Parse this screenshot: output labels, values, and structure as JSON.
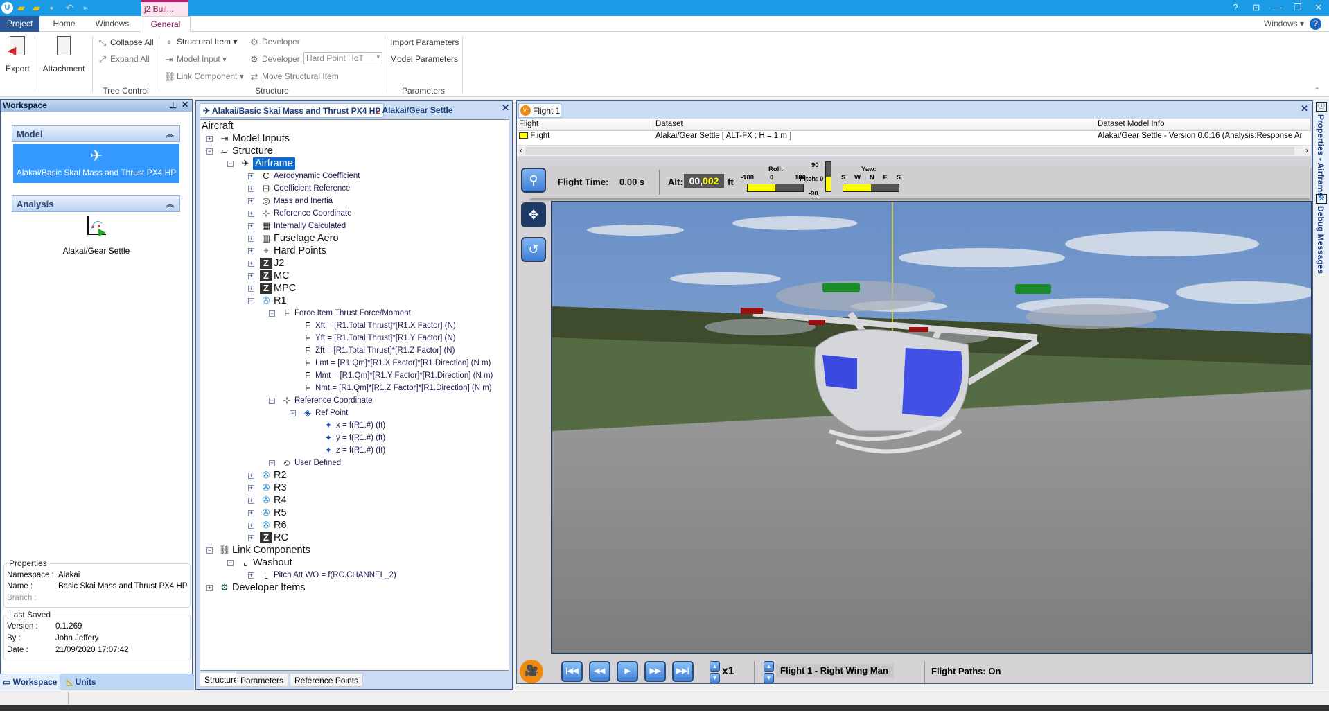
{
  "titlebar": {
    "doc_tab": "j2 Buil...",
    "buttons": [
      "help",
      "restore-ribbon",
      "minimize",
      "restore",
      "close"
    ]
  },
  "ribbon_tabs": [
    "Project",
    "Home",
    "Windows",
    "General"
  ],
  "ribbon_right": {
    "windows": "Windows"
  },
  "ribbon": {
    "export": "Export",
    "attachment": "Attachment",
    "collapse_all": "Collapse All",
    "expand_all": "Expand All",
    "tree_control": "Tree Control",
    "structural_item": "Structural Item",
    "model_input": "Model Input",
    "link_component": "Link Component",
    "developer1": "Developer",
    "developer2": "Developer",
    "developer_combo": "Hard Point HoT",
    "move_structural_item": "Move Structural Item",
    "structure": "Structure",
    "import_parameters": "Import Parameters",
    "model_parameters": "Model Parameters",
    "parameters": "Parameters"
  },
  "workspace": {
    "title": "Workspace",
    "model_header": "Model",
    "model_item": "Alakai/Basic Skai Mass and Thrust PX4 HP",
    "analysis_header": "Analysis",
    "analysis_item": "Alakai/Gear Settle",
    "properties": {
      "legend": "Properties",
      "namespace_label": "Namespace :",
      "namespace": "Alakai",
      "name_label": "Name :",
      "name": "Basic Skai Mass and Thrust PX4 HP",
      "branch_label": "Branch :"
    },
    "last_saved": {
      "legend": "Last Saved",
      "version_label": "Version :",
      "version": "0.1.269",
      "by_label": "By :",
      "by": "John Jeffery",
      "date_label": "Date :",
      "date": "21/09/2020 17:07:42"
    },
    "tabs": [
      "Workspace",
      "Units"
    ]
  },
  "tree_panel": {
    "tabs": [
      "Alakai/Basic Skai Mass and Thrust PX4 HP",
      "Alakai/Gear Settle"
    ],
    "root": "Aircraft",
    "items": [
      {
        "label": "Model Inputs",
        "level": 0,
        "toggle": "+",
        "icon": "model-input-icon",
        "big": true
      },
      {
        "label": "Structure",
        "level": 0,
        "toggle": "-",
        "icon": "structure-icon",
        "big": true
      },
      {
        "label": "Airframe",
        "level": 1,
        "toggle": "-",
        "icon": "airframe-icon",
        "big": true,
        "selected": true
      },
      {
        "label": "Aerodynamic Coefficient",
        "level": 2,
        "toggle": "+",
        "icon": "coefficient-icon"
      },
      {
        "label": "Coefficient Reference",
        "level": 2,
        "toggle": "+",
        "icon": "coefficient-reference-icon"
      },
      {
        "label": "Mass and Inertia",
        "level": 2,
        "toggle": "+",
        "icon": "mass-inertia-icon"
      },
      {
        "label": "Reference Coordinate",
        "level": 2,
        "toggle": "+",
        "icon": "reference-coordinate-icon"
      },
      {
        "label": "Internally Calculated",
        "level": 2,
        "toggle": "+",
        "icon": "calculator-icon"
      },
      {
        "label": "Fuselage Aero",
        "level": 2,
        "toggle": "+",
        "icon": "fuselage-aero-icon",
        "big": true
      },
      {
        "label": "Hard Points",
        "level": 2,
        "toggle": "+",
        "icon": "hard-point-icon",
        "big": true
      },
      {
        "label": "J2",
        "level": 2,
        "toggle": "+",
        "icon": "z-block-icon",
        "big": true
      },
      {
        "label": "MC",
        "level": 2,
        "toggle": "+",
        "icon": "z-block-icon",
        "big": true
      },
      {
        "label": "MPC",
        "level": 2,
        "toggle": "+",
        "icon": "z-block-icon",
        "big": true
      },
      {
        "label": "R1",
        "level": 2,
        "toggle": "-",
        "icon": "rotor-icon",
        "big": true
      },
      {
        "label": "Force Item Thrust Force/Moment",
        "level": 3,
        "toggle": "-",
        "icon": "force-moment-icon"
      },
      {
        "label": "Xft = [R1.Total Thrust]*[R1.X Factor] (N)",
        "level": 4,
        "icon": "force-icon"
      },
      {
        "label": "Yft = [R1.Total Thrust]*[R1.Y Factor] (N)",
        "level": 4,
        "icon": "force-icon"
      },
      {
        "label": "Zft = [R1.Total Thrust]*[R1.Z Factor] (N)",
        "level": 4,
        "icon": "force-icon"
      },
      {
        "label": "Lmt = [R1.Qm]*[R1.X Factor]*[R1.Direction] (N m)",
        "level": 4,
        "icon": "force-icon"
      },
      {
        "label": "Mmt = [R1.Qm]*[R1.Y Factor]*[R1.Direction] (N m)",
        "level": 4,
        "icon": "force-icon"
      },
      {
        "label": "Nmt = [R1.Qm]*[R1.Z Factor]*[R1.Direction] (N m)",
        "level": 4,
        "icon": "force-icon"
      },
      {
        "label": "Reference Coordinate",
        "level": 3,
        "toggle": "-",
        "icon": "reference-coordinate-icon"
      },
      {
        "label": "Ref Point",
        "level": 4,
        "toggle": "-",
        "icon": "ref-point-icon"
      },
      {
        "label": "x = f(R1.#) (ft)",
        "level": 5,
        "icon": "crosshair-icon"
      },
      {
        "label": "y = f(R1.#) (ft)",
        "level": 5,
        "icon": "crosshair-icon"
      },
      {
        "label": "z = f(R1.#) (ft)",
        "level": 5,
        "icon": "crosshair-icon"
      },
      {
        "label": "User Defined",
        "level": 3,
        "toggle": "+",
        "icon": "user-icon"
      },
      {
        "label": "R2",
        "level": 2,
        "toggle": "+",
        "icon": "rotor-icon",
        "big": true
      },
      {
        "label": "R3",
        "level": 2,
        "toggle": "+",
        "icon": "rotor-icon",
        "big": true
      },
      {
        "label": "R4",
        "level": 2,
        "toggle": "+",
        "icon": "rotor-icon",
        "big": true
      },
      {
        "label": "R5",
        "level": 2,
        "toggle": "+",
        "icon": "rotor-icon",
        "big": true
      },
      {
        "label": "R6",
        "level": 2,
        "toggle": "+",
        "icon": "rotor-icon",
        "big": true
      },
      {
        "label": "RC",
        "level": 2,
        "toggle": "+",
        "icon": "z-block-icon",
        "big": true
      },
      {
        "label": "Link Components",
        "level": 0,
        "toggle": "-",
        "icon": "link-icon",
        "big": true
      },
      {
        "label": "Washout",
        "level": 1,
        "toggle": "-",
        "icon": "washout-icon",
        "big": true
      },
      {
        "label": "Pitch Att WO =  f(RC.CHANNEL_2)",
        "level": 2,
        "toggle": "+",
        "icon": "washout-curve-icon"
      },
      {
        "label": "Developer Items",
        "level": 0,
        "toggle": "+",
        "icon": "gear-icon",
        "big": true
      }
    ],
    "bottom_tabs": [
      "Structure",
      "Parameters",
      "Reference Points"
    ]
  },
  "flight": {
    "tab": "Flight 1",
    "columns": [
      "Flight",
      "Dataset",
      "Dataset Model Info"
    ],
    "row": {
      "flight": "Flight",
      "dataset": "Alakai/Gear Settle [ ALT-FX : H = 1 m ]",
      "info": "Alakai/Gear Settle - Version 0.0.16 (Analysis:Response Ar"
    },
    "instruments": {
      "flight_time_label": "Flight Time:",
      "flight_time": "0.00 s",
      "alt_label": "Alt:",
      "alt_white": "00,",
      "alt_yellow": "002",
      "alt_unit": "ft",
      "roll_label": "Roll:",
      "roll_ticks": [
        "-180",
        "0",
        "180"
      ],
      "roll_value": 0,
      "pitch_label": "Pitch: 0",
      "pitch_top": "90",
      "pitch_bottom": "-90",
      "pitch_value": 0,
      "yaw_label": "Yaw:",
      "yaw_ticks": [
        "S",
        "W",
        "N",
        "E",
        "S"
      ],
      "yaw_value": 0
    },
    "controls": {
      "speed": "x1",
      "camera": "Flight 1 - Right Wing Man",
      "flight_paths": "Flight Paths: On"
    },
    "colors": {
      "gauge_fill": "#ffff00",
      "sky": "#6d92c8",
      "tarmac": "#8a8a8a"
    }
  },
  "right_strip": [
    "Properties - Airframe",
    "Debug Messages"
  ]
}
